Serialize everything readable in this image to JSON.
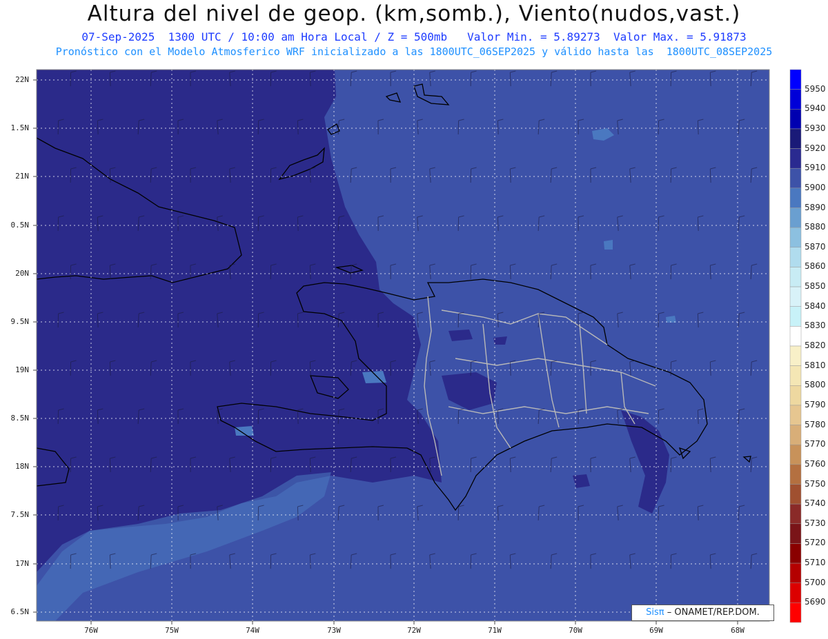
{
  "title": "Altura del nivel de geop. (km,somb.), Viento(nudos,vast.)",
  "subtitle1": "07-Sep-2025  1300 UTC / 10:00 am Hora Local / Z = 500mb   Valor Min. = 5.89273  Valor Max. = 5.91873",
  "subtitle2": "Pronóstico con el Modelo Atmosferico WRF inicializado a las 1800UTC_06SEP2025 y válido hasta las  1800UTC_08SEP2025",
  "lat_labels": [
    "22N",
    "1.5N",
    "21N",
    "0.5N",
    "20N",
    "9.5N",
    "19N",
    "8.5N",
    "18N",
    "7.5N",
    "17N",
    "6.5N"
  ],
  "lon_labels": [
    "76W",
    "75W",
    "74W",
    "73W",
    "72W",
    "71W",
    "70W",
    "69W",
    "68W"
  ],
  "colorbar": {
    "labels": [
      "5950",
      "5940",
      "5930",
      "5920",
      "5910",
      "5900",
      "5890",
      "5880",
      "5870",
      "5860",
      "5850",
      "5840",
      "5830",
      "5820",
      "5810",
      "5800",
      "5790",
      "5780",
      "5770",
      "5760",
      "5750",
      "5740",
      "5730",
      "5720",
      "5710",
      "5700",
      "5690"
    ],
    "colors": [
      "#0000ff",
      "#0000d8",
      "#0000b0",
      "#1a1a78",
      "#2a2a90",
      "#3d52a8",
      "#4a78c0",
      "#6a9fd0",
      "#8cc0e0",
      "#b0dcee",
      "#c8ecf4",
      "#d8f2f8",
      "#c8f2f8",
      "#fff",
      "#f8f0c8",
      "#f4e6b4",
      "#eed8a0",
      "#e6c690",
      "#d8ae78",
      "#c8925a",
      "#b47040",
      "#a05030",
      "#8a2a28",
      "#7a1418",
      "#8a0000",
      "#b40000",
      "#dc0000",
      "#ff0000"
    ]
  },
  "field_colors": {
    "deep": "#2b2a8a",
    "mid": "#3d52a8",
    "light": "#4a78c0"
  },
  "credit": {
    "sis": "Sisπ",
    "rest": "– ONAMET/REP.DOM."
  }
}
